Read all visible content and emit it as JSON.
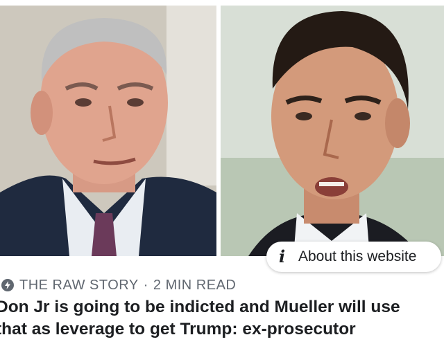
{
  "article": {
    "source": "THE RAW STORY",
    "separator": "·",
    "read_time": "2 MIN READ",
    "headline_line1": "Don Jr is going to be indicted and Mueller will use",
    "headline_line2": "that as leverage to get Trump: ex-prosecutor"
  },
  "about_button": {
    "icon": "info-i-icon",
    "label": "About this website"
  },
  "images": {
    "left": "portrait-photo-left",
    "right": "portrait-photo-right"
  },
  "colors": {
    "meta_text": "#606770",
    "headline_text": "#1c1e21",
    "background": "#ffffff"
  }
}
